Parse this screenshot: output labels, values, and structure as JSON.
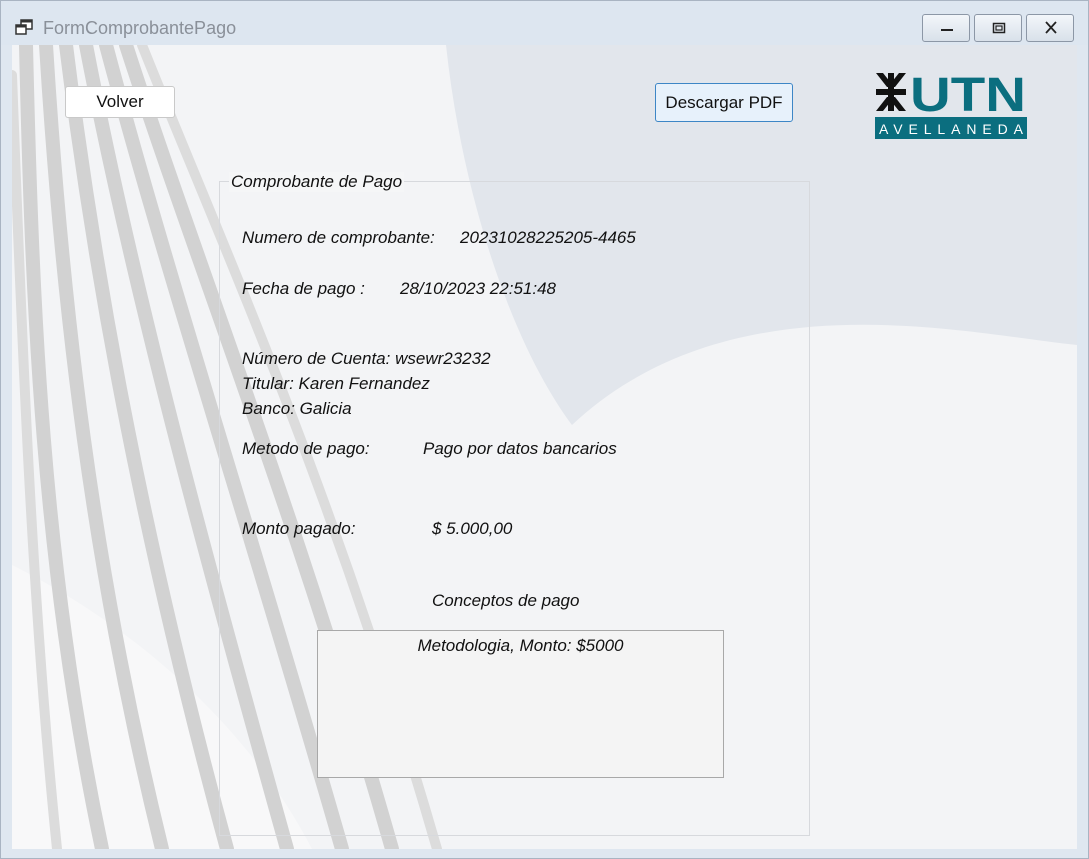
{
  "window": {
    "title": "FormComprobantePago"
  },
  "toolbar": {
    "back_label": "Volver",
    "pdf_label": "Descargar PDF"
  },
  "logo": {
    "main_text": "UTN",
    "sub_text": "AVELLANEDA",
    "primary_color": "#0b6e7f",
    "icon": "utn-emblem-icon"
  },
  "receipt": {
    "group_title": "Comprobante de Pago",
    "number_label": "Numero de comprobante:",
    "number_value": "20231028225205-4465",
    "date_label": "Fecha de pago :",
    "date_value": "28/10/2023 22:51:48",
    "account_line": "Número de Cuenta: wsewr23232",
    "holder_line": "Titular: Karen Fernandez",
    "bank_line": "Banco: Galicia",
    "method_label": "Metodo de pago:",
    "method_value": "Pago por datos bancarios",
    "amount_label": "Monto pagado:",
    "amount_value": "$ 5.000,00",
    "concepts_title": "Conceptos de pago",
    "concepts": [
      "Metodologia, Monto: $5000"
    ]
  }
}
